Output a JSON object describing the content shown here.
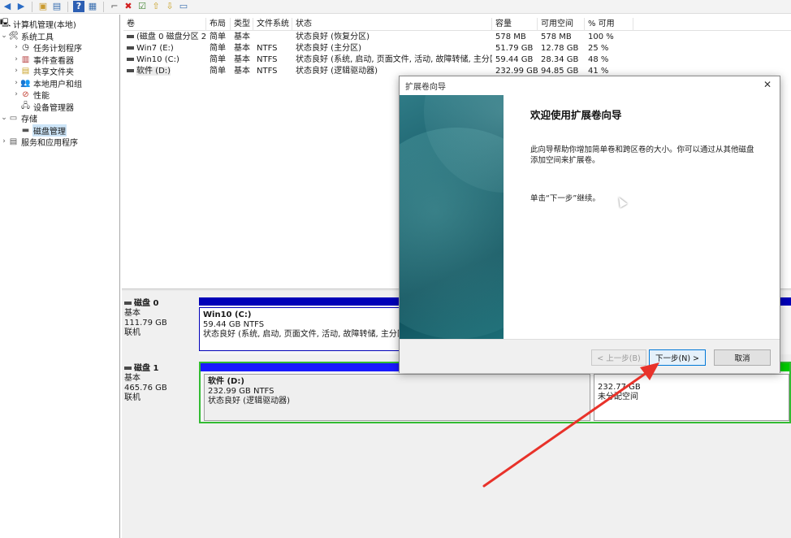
{
  "toolbar": {
    "icons": [
      "back-icon",
      "forward-icon",
      "up-icon",
      "show-hide-tree-icon",
      "help-icon",
      "properties-icon",
      "connect-icon",
      "delete-icon",
      "check-icon",
      "import-icon",
      "export-icon",
      "view-icon"
    ]
  },
  "tree": {
    "root": "计算机管理(本地)",
    "items": [
      {
        "label": "系统工具",
        "icon": "tools-icon",
        "level": 1,
        "expanded": true
      },
      {
        "label": "任务计划程序",
        "icon": "clock-icon",
        "level": 2
      },
      {
        "label": "事件查看器",
        "icon": "event-viewer-icon",
        "level": 2
      },
      {
        "label": "共享文件夹",
        "icon": "shared-folder-icon",
        "level": 2
      },
      {
        "label": "本地用户和组",
        "icon": "users-icon",
        "level": 2
      },
      {
        "label": "性能",
        "icon": "performance-icon",
        "level": 2
      },
      {
        "label": "设备管理器",
        "icon": "device-manager-icon",
        "level": 2
      },
      {
        "label": "存储",
        "icon": "storage-icon",
        "level": 1,
        "expanded": true
      },
      {
        "label": "磁盘管理",
        "icon": "disk-management-icon",
        "level": 2,
        "selected": true
      },
      {
        "label": "服务和应用程序",
        "icon": "services-icon",
        "level": 1
      }
    ]
  },
  "volumes": {
    "headers": [
      "卷",
      "布局",
      "类型",
      "文件系统",
      "状态",
      "容量",
      "可用空间",
      "% 可用"
    ],
    "rows": [
      [
        "(磁盘 0 磁盘分区 2)",
        "简单",
        "基本",
        "",
        "状态良好 (恢复分区)",
        "578 MB",
        "578 MB",
        "100 %"
      ],
      [
        "Win7 (E:)",
        "简单",
        "基本",
        "NTFS",
        "状态良好 (主分区)",
        "51.79 GB",
        "12.78 GB",
        "25 %"
      ],
      [
        "Win10 (C:)",
        "简单",
        "基本",
        "NTFS",
        "状态良好 (系统, 启动, 页面文件, 活动, 故障转储, 主分区)",
        "59.44 GB",
        "28.34 GB",
        "48 %"
      ],
      [
        "软件 (D:)",
        "简单",
        "基本",
        "NTFS",
        "状态良好 (逻辑驱动器)",
        "232.99 GB",
        "94.85 GB",
        "41 %"
      ]
    ]
  },
  "disks": [
    {
      "name": "磁盘 0",
      "type": "基本",
      "size": "111.79 GB",
      "status": "联机",
      "partition": {
        "name": "Win10  (C:)",
        "size": "59.44 GB NTFS",
        "status": "状态良好 (系统, 启动, 页面文件, 活动, 故障转储, 主分区)"
      }
    },
    {
      "name": "磁盘 1",
      "type": "基本",
      "size": "465.76 GB",
      "status": "联机",
      "partition": {
        "name": "软件  (D:)",
        "size": "232.99 GB NTFS",
        "status": "状态良好 (逻辑驱动器)"
      },
      "unallocated": {
        "size": "232.77 GB",
        "status": "未分配空间"
      }
    }
  ],
  "dialog": {
    "title": "扩展卷向导",
    "heading": "欢迎使用扩展卷向导",
    "description": "此向导帮助你增加简单卷和跨区卷的大小。你可以通过从其他磁盘添加空间来扩展卷。",
    "hint": "单击“下一步”继续。",
    "buttons": {
      "back": "< 上一步(B)",
      "next": "下一步(N) >",
      "cancel": "取消"
    }
  },
  "colors": {
    "primary_partition_bar": "#0000b8",
    "logical_bar": "#1a1aff",
    "unallocated_bar": "#00cc00",
    "annotation_arrow": "#e8322a"
  }
}
